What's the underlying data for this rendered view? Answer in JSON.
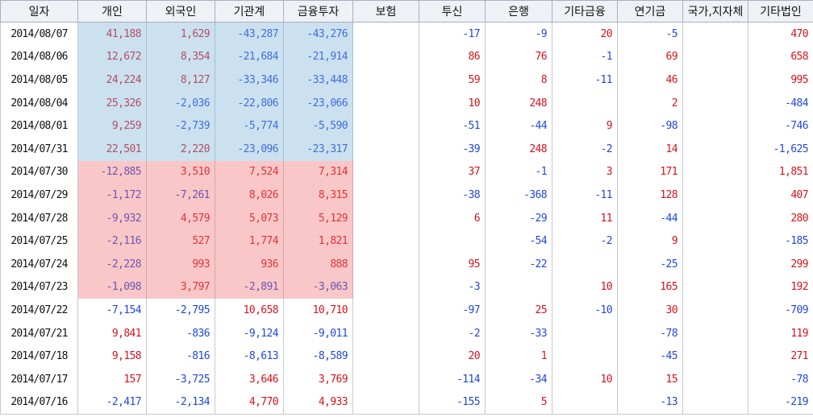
{
  "columns": [
    "일자",
    "개인",
    "외국인",
    "기관계",
    "금융투자",
    "보험",
    "투신",
    "은행",
    "기타금융",
    "연기금",
    "국가,지자체",
    "기타법인"
  ],
  "rows": [
    [
      "2014/08/07",
      "41,188",
      "1,629",
      "-43,287",
      "-43,276",
      "",
      "-17",
      "-9",
      "20",
      "-5",
      "",
      "470"
    ],
    [
      "2014/08/06",
      "12,672",
      "8,354",
      "-21,684",
      "-21,914",
      "",
      "86",
      "76",
      "-1",
      "69",
      "",
      "658"
    ],
    [
      "2014/08/05",
      "24,224",
      "8,127",
      "-33,346",
      "-33,448",
      "",
      "59",
      "8",
      "-11",
      "46",
      "",
      "995"
    ],
    [
      "2014/08/04",
      "25,326",
      "-2,036",
      "-22,806",
      "-23,066",
      "",
      "10",
      "248",
      "",
      "2",
      "",
      "-484"
    ],
    [
      "2014/08/01",
      "9,259",
      "-2,739",
      "-5,774",
      "-5,590",
      "",
      "-51",
      "-44",
      "9",
      "-98",
      "",
      "-746"
    ],
    [
      "2014/07/31",
      "22,501",
      "2,220",
      "-23,096",
      "-23,317",
      "",
      "-39",
      "248",
      "-2",
      "14",
      "",
      "-1,625"
    ],
    [
      "2014/07/30",
      "-12,885",
      "3,510",
      "7,524",
      "7,314",
      "",
      "37",
      "-1",
      "3",
      "171",
      "",
      "1,851"
    ],
    [
      "2014/07/29",
      "-1,172",
      "-7,261",
      "8,026",
      "8,315",
      "",
      "-38",
      "-368",
      "-11",
      "128",
      "",
      "407"
    ],
    [
      "2014/07/28",
      "-9,932",
      "4,579",
      "5,073",
      "5,129",
      "",
      "6",
      "-29",
      "11",
      "-44",
      "",
      "280"
    ],
    [
      "2014/07/25",
      "-2,116",
      "527",
      "1,774",
      "1,821",
      "",
      "",
      "-54",
      "-2",
      "9",
      "",
      "-185"
    ],
    [
      "2014/07/24",
      "-2,228",
      "993",
      "936",
      "888",
      "",
      "95",
      "-22",
      "",
      "-25",
      "",
      "299"
    ],
    [
      "2014/07/23",
      "-1,098",
      "3,797",
      "-2,891",
      "-3,063",
      "",
      "-3",
      "",
      "10",
      "165",
      "",
      "192"
    ],
    [
      "2014/07/22",
      "-7,154",
      "-2,795",
      "10,658",
      "10,710",
      "",
      "-97",
      "25",
      "-10",
      "30",
      "",
      "-709"
    ],
    [
      "2014/07/21",
      "9,841",
      "-836",
      "-9,124",
      "-9,011",
      "",
      "-2",
      "-33",
      "",
      "-78",
      "",
      "119"
    ],
    [
      "2014/07/18",
      "9,158",
      "-816",
      "-8,613",
      "-8,589",
      "",
      "20",
      "1",
      "",
      "-45",
      "",
      "271"
    ],
    [
      "2014/07/17",
      "157",
      "-3,725",
      "3,646",
      "3,769",
      "",
      "-114",
      "-34",
      "10",
      "15",
      "",
      "-78"
    ],
    [
      "2014/07/16",
      "-2,417",
      "-2,134",
      "4,770",
      "4,933",
      "",
      "-155",
      "5",
      "",
      "-13",
      "",
      "-219"
    ]
  ],
  "highlights": [
    {
      "color": "blue",
      "row_start": 0,
      "row_end": 5,
      "col_start": 1,
      "col_end": 4
    },
    {
      "color": "red",
      "row_start": 6,
      "row_end": 11,
      "col_start": 1,
      "col_end": 4
    }
  ]
}
